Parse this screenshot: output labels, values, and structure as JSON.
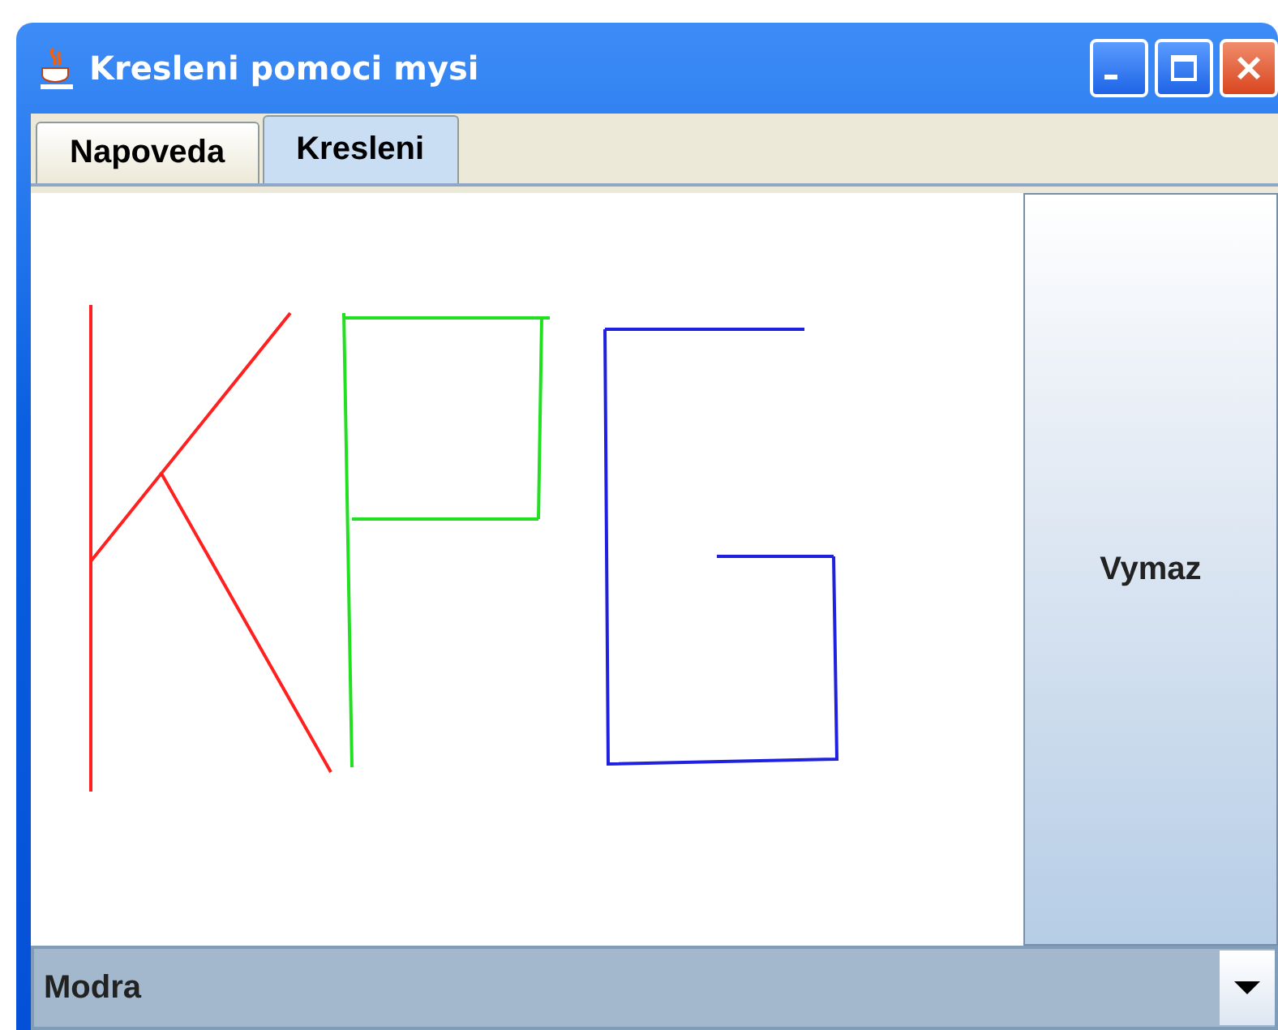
{
  "window": {
    "title": "Kresleni pomoci mysi"
  },
  "tabs": [
    {
      "label": "Napoveda",
      "selected": false
    },
    {
      "label": "Kresleni",
      "selected": true
    }
  ],
  "clear_button": {
    "label": "Vymaz"
  },
  "color_combo": {
    "value": "Modra"
  }
}
